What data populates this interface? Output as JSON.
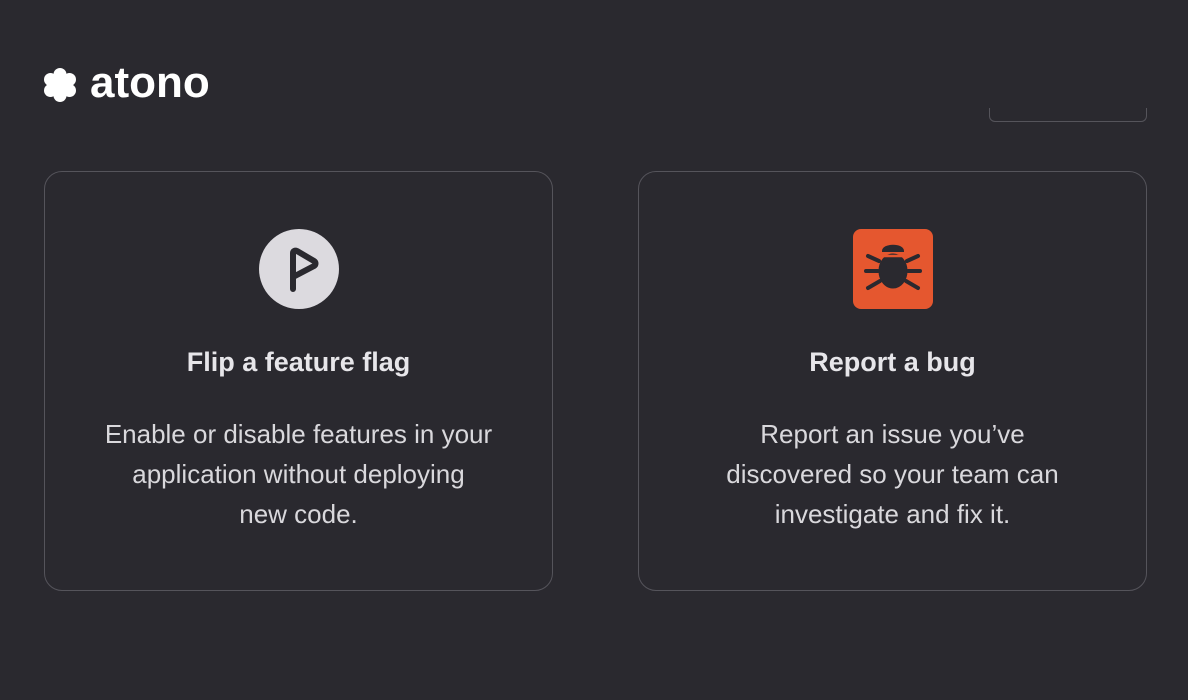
{
  "brand": {
    "name": "atono",
    "logo_icon": "flower-logo-icon"
  },
  "colors": {
    "background": "#2a292f",
    "card_border": "#55545b",
    "bug_accent": "#e5572f",
    "flag_icon_bg": "#dcdadf",
    "text_primary": "#e7e6ea"
  },
  "cards": [
    {
      "icon": "flag-icon",
      "title": "Flip a feature flag",
      "description_lines": [
        "Enable or disable features in your",
        "application without deploying",
        "new code."
      ]
    },
    {
      "icon": "bug-icon",
      "title": "Report a bug",
      "description_lines": [
        "Report an issue you’ve",
        "discovered so your team can",
        "investigate and fix it."
      ]
    }
  ]
}
